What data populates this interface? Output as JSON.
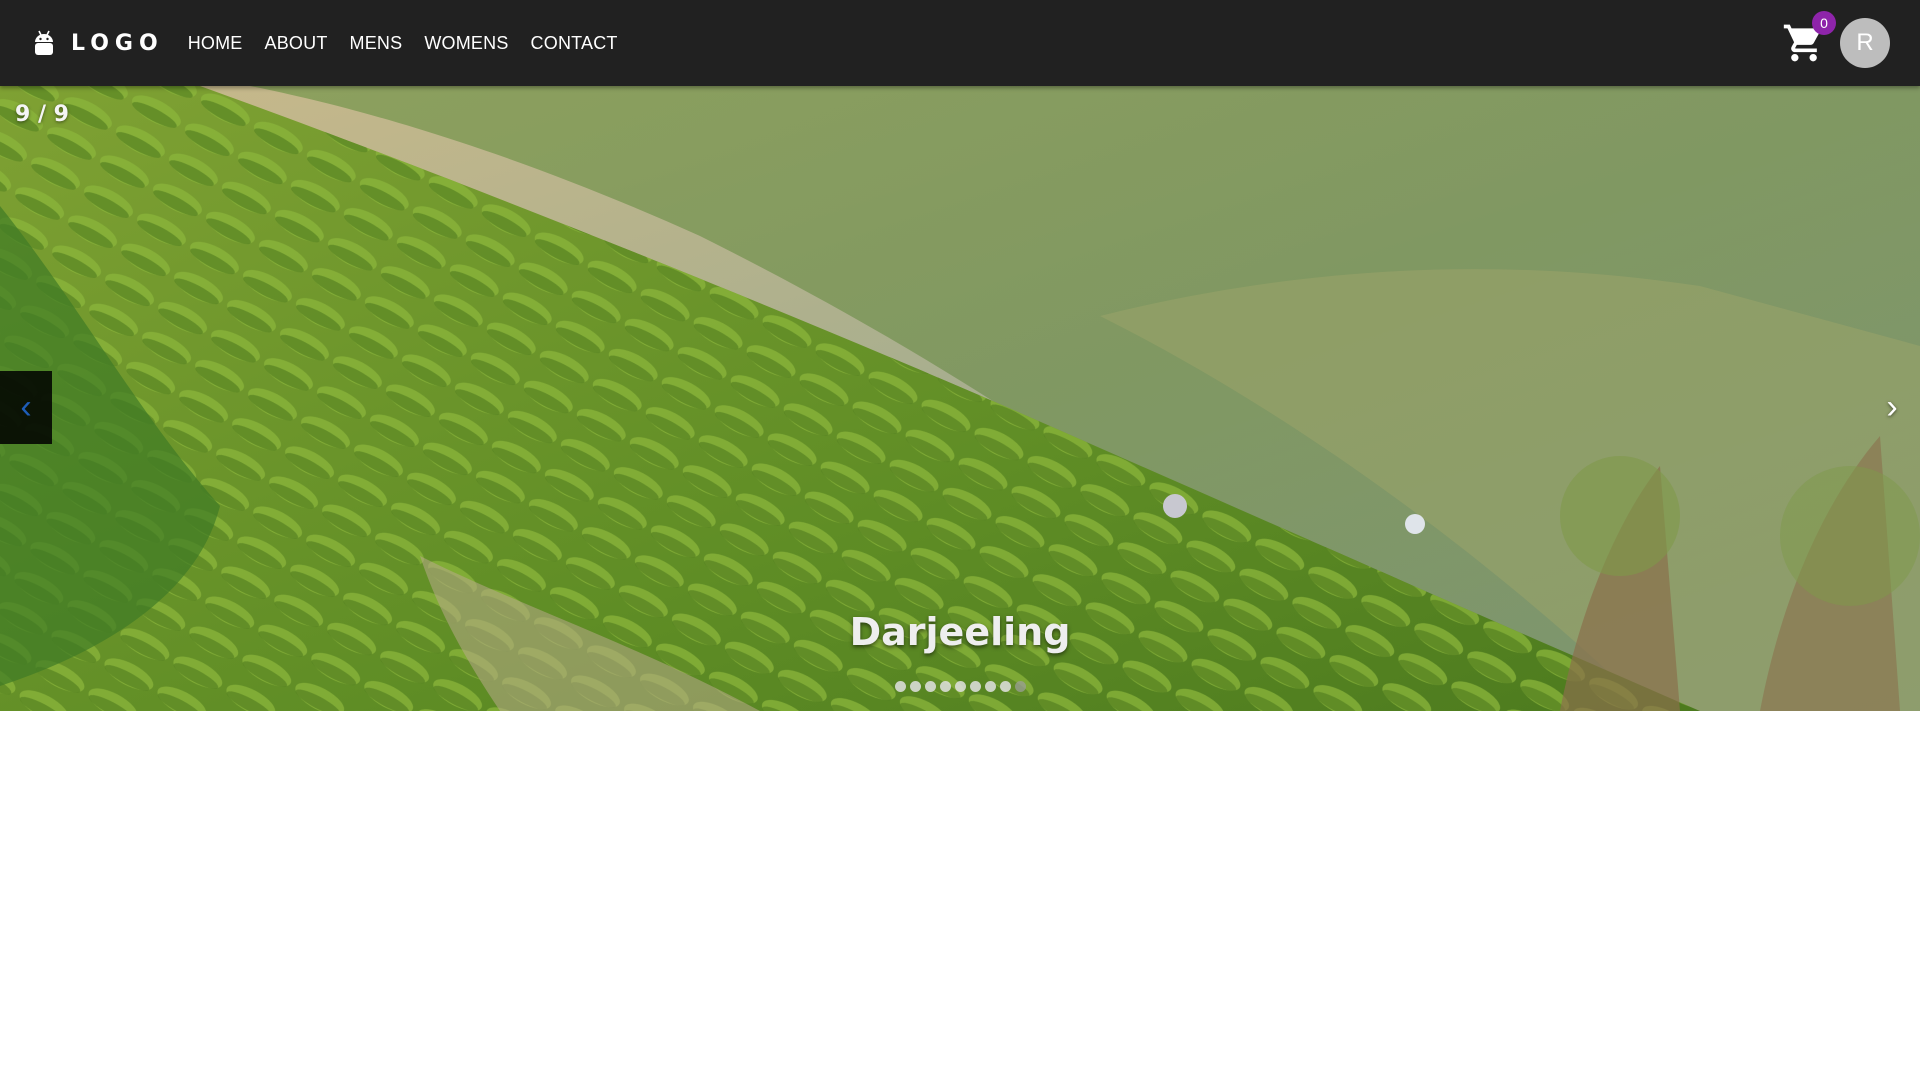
{
  "navbar": {
    "logo_text": "LOGO",
    "logo_icon": "android-icon",
    "links": [
      "HOME",
      "ABOUT",
      "MENS",
      "WOMENS",
      "CONTACT"
    ],
    "cart_icon": "shopping-cart-icon",
    "cart_count": "0",
    "avatar_letter": "R",
    "colors": {
      "background": "#212121",
      "badge": "#8e24aa",
      "avatar": "#bdbdbd"
    }
  },
  "carousel": {
    "counter": "9 / 9",
    "prev_label": "‹",
    "next_label": "›",
    "caption": "Darjeeling",
    "slide_count": 9,
    "active_index": 8,
    "prev_icon": "chevron-left-icon",
    "next_icon": "chevron-right-icon"
  }
}
